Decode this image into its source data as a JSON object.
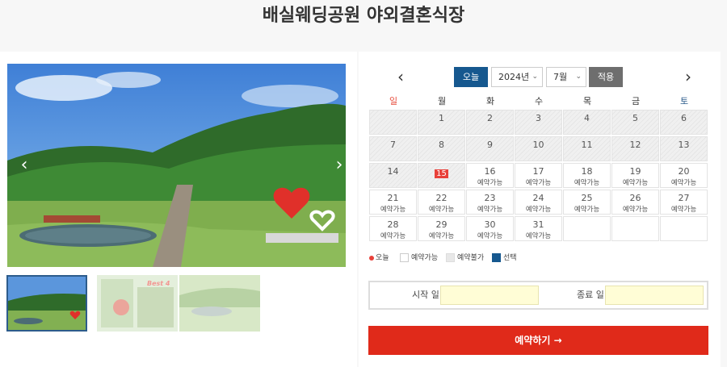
{
  "page": {
    "title": "배실웨딩공원 야외결혼식장"
  },
  "gallery": {
    "prev_arrow": "‹",
    "next_arrow": "›",
    "thumb2_badge": "Best 4"
  },
  "calendar": {
    "prev": "‹",
    "next": "›",
    "today_label": "오늘",
    "year_value": "2024년",
    "month_value": "7월",
    "apply_label": "적용",
    "weekdays": [
      "일",
      "월",
      "화",
      "수",
      "목",
      "금",
      "토"
    ],
    "rows": [
      [
        {
          "d": "",
          "s": "",
          "past": true
        },
        {
          "d": "1",
          "s": "",
          "past": true
        },
        {
          "d": "2",
          "s": "",
          "past": true
        },
        {
          "d": "3",
          "s": "",
          "past": true
        },
        {
          "d": "4",
          "s": "",
          "past": true
        },
        {
          "d": "5",
          "s": "",
          "past": true
        },
        {
          "d": "6",
          "s": "",
          "past": true
        }
      ],
      [
        {
          "d": "7",
          "s": "",
          "past": true
        },
        {
          "d": "8",
          "s": "",
          "past": true
        },
        {
          "d": "9",
          "s": "",
          "past": true
        },
        {
          "d": "10",
          "s": "",
          "past": true
        },
        {
          "d": "11",
          "s": "",
          "past": true
        },
        {
          "d": "12",
          "s": "",
          "past": true
        },
        {
          "d": "13",
          "s": "",
          "past": true
        }
      ],
      [
        {
          "d": "14",
          "s": "",
          "past": true
        },
        {
          "d": "15",
          "s": "",
          "past": true,
          "today": true
        },
        {
          "d": "16",
          "s": "예약가능"
        },
        {
          "d": "17",
          "s": "예약가능"
        },
        {
          "d": "18",
          "s": "예약가능"
        },
        {
          "d": "19",
          "s": "예약가능"
        },
        {
          "d": "20",
          "s": "예약가능"
        }
      ],
      [
        {
          "d": "21",
          "s": "예약가능"
        },
        {
          "d": "22",
          "s": "예약가능"
        },
        {
          "d": "23",
          "s": "예약가능"
        },
        {
          "d": "24",
          "s": "예약가능"
        },
        {
          "d": "25",
          "s": "예약가능"
        },
        {
          "d": "26",
          "s": "예약가능"
        },
        {
          "d": "27",
          "s": "예약가능"
        }
      ],
      [
        {
          "d": "28",
          "s": "예약가능"
        },
        {
          "d": "29",
          "s": "예약가능"
        },
        {
          "d": "30",
          "s": "예약가능"
        },
        {
          "d": "31",
          "s": "예약가능"
        },
        {
          "d": "",
          "s": ""
        },
        {
          "d": "",
          "s": ""
        },
        {
          "d": "",
          "s": ""
        }
      ]
    ]
  },
  "legend": {
    "today": "오늘",
    "available": "예약가능",
    "unavailable": "예약불가",
    "selected": "선택"
  },
  "dates": {
    "start_label": "시작 일",
    "start_value": "",
    "end_label": "종료 일",
    "end_value": ""
  },
  "reserve_button": "예약하기  →",
  "colors": {
    "accent_blue": "#16588f",
    "reserve_red": "#e02a1a",
    "today_red": "#e8413a",
    "input_yellow": "#fffdd6"
  }
}
